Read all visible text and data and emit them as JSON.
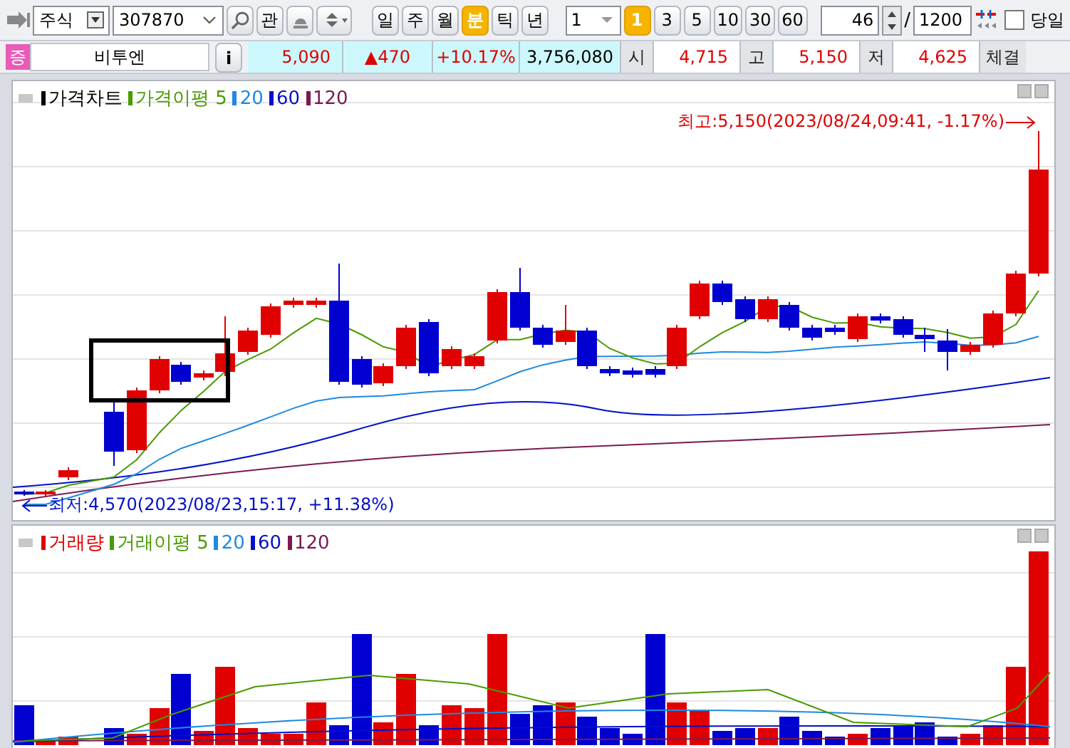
{
  "toolbar": {
    "market_select": "주식",
    "code_field": "307870",
    "watch_button": "관",
    "period_tabs": [
      {
        "label": "일",
        "selected": false
      },
      {
        "label": "주",
        "selected": false
      },
      {
        "label": "월",
        "selected": false
      },
      {
        "label": "분",
        "selected": true
      },
      {
        "label": "틱",
        "selected": false
      },
      {
        "label": "년",
        "selected": false
      }
    ],
    "interval_select": "1",
    "interval_tabs": [
      {
        "label": "1",
        "selected": true
      },
      {
        "label": "3",
        "selected": false
      },
      {
        "label": "5",
        "selected": false
      },
      {
        "label": "10",
        "selected": false
      },
      {
        "label": "30",
        "selected": false
      },
      {
        "label": "60",
        "selected": false
      }
    ],
    "count_field": "46",
    "separator": "/",
    "total_field": "1200",
    "today_checkbox": {
      "label": "당일",
      "checked": false
    }
  },
  "quote": {
    "badge": "증",
    "name": "비투엔",
    "info_button": "i",
    "price": "5,090",
    "change": "▲470",
    "rate": "+10.17%",
    "volume": "3,756,080",
    "stats": [
      {
        "label": "시",
        "value": "4,715"
      },
      {
        "label": "고",
        "value": "5,150"
      },
      {
        "label": "저",
        "value": "4,625"
      }
    ],
    "trailing_label": "체결"
  },
  "price_panel": {
    "legend": [
      {
        "label": "가격차트",
        "color": "#000000"
      },
      {
        "label": "가격이평 5",
        "color": "#4a9a00"
      },
      {
        "label": "20",
        "color": "#1e8ae0"
      },
      {
        "label": "60",
        "color": "#0010c8"
      },
      {
        "label": "120",
        "color": "#7a1a50"
      }
    ],
    "high_note": "최고:5,150(2023/08/24,09:41, -1.17%)",
    "low_note": "최저:4,570(2023/08/23,15:17, +11.38%)"
  },
  "volume_panel": {
    "legend": [
      {
        "label": "거래량",
        "color": "#e00000"
      },
      {
        "label": "거래이평 5",
        "color": "#4a9a00"
      },
      {
        "label": "20",
        "color": "#1e8ae0"
      },
      {
        "label": "60",
        "color": "#0010c8"
      },
      {
        "label": "120",
        "color": "#7a1a50"
      }
    ]
  }
}
